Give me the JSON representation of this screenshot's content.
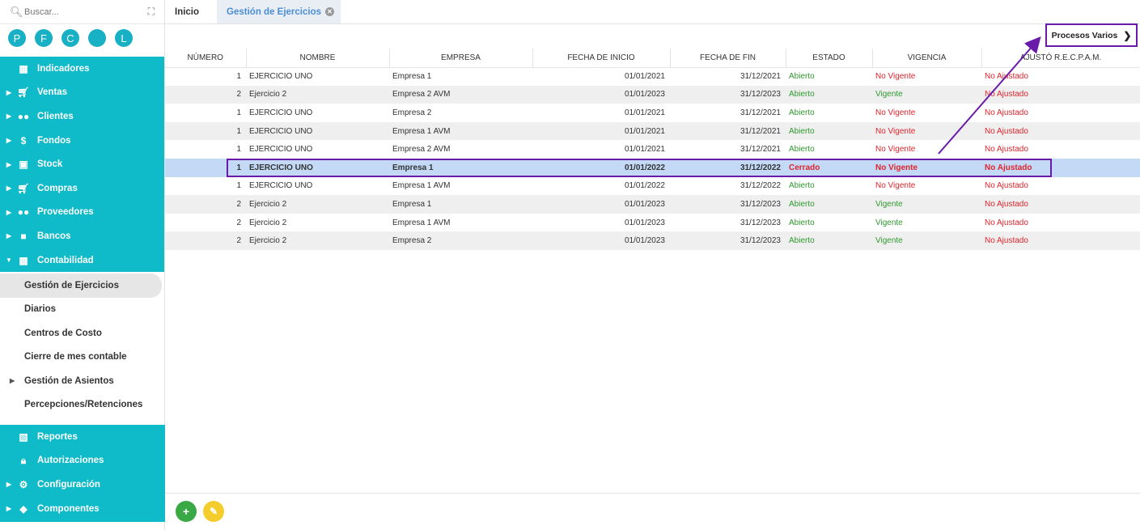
{
  "search": {
    "placeholder": "Buscar..."
  },
  "quick_circles": [
    "P",
    "F",
    "C",
    "",
    "L"
  ],
  "sidebar": {
    "items": [
      {
        "label": "Indicadores",
        "icon": "dashboard-icon",
        "caret": false
      },
      {
        "label": "Ventas",
        "icon": "cart-icon",
        "caret": true
      },
      {
        "label": "Clientes",
        "icon": "people-icon",
        "caret": true
      },
      {
        "label": "Fondos",
        "icon": "dollar-icon",
        "caret": true
      },
      {
        "label": "Stock",
        "icon": "box-icon",
        "caret": true
      },
      {
        "label": "Compras",
        "icon": "purchase-cart-icon",
        "caret": true
      },
      {
        "label": "Proveedores",
        "icon": "people-icon",
        "caret": true
      },
      {
        "label": "Bancos",
        "icon": "briefcase-icon",
        "caret": true
      },
      {
        "label": "Contabilidad",
        "icon": "book-icon",
        "caret": "open"
      }
    ],
    "sub_items": [
      {
        "label": "Gestión de Ejercicios",
        "active": true
      },
      {
        "label": "Diarios"
      },
      {
        "label": "Centros de Costo"
      },
      {
        "label": "Cierre de mes contable"
      },
      {
        "label": "Gestión de Asientos",
        "caret": true
      },
      {
        "label": "Percepciones/Retenciones"
      }
    ],
    "bottom_items": [
      {
        "label": "Reportes",
        "icon": "report-icon",
        "caret": false
      },
      {
        "label": "Autorizaciones",
        "icon": "lock-icon",
        "caret": false
      },
      {
        "label": "Configuración",
        "icon": "gears-icon",
        "caret": true
      },
      {
        "label": "Componentes",
        "icon": "tag-icon",
        "caret": true
      }
    ]
  },
  "tabs": [
    {
      "label": "Inicio"
    },
    {
      "label": "Gestión de Ejercicios",
      "active": true
    }
  ],
  "procesos": {
    "label": "Procesos Varios"
  },
  "table": {
    "columns": [
      "NÚMERO",
      "NOMBRE",
      "EMPRESA",
      "FECHA DE INICIO",
      "FECHA DE FIN",
      "ESTADO",
      "VIGENCIA",
      "AJUSTÓ R.E.C.P.A.M."
    ],
    "rows": [
      [
        "1",
        "EJERCICIO UNO",
        "Empresa 1",
        "01/01/2021",
        "31/12/2021",
        "Abierto",
        "No Vigente",
        "No Ajustado"
      ],
      [
        "2",
        "Ejercicio 2",
        "Empresa 2 AVM",
        "01/01/2023",
        "31/12/2023",
        "Abierto",
        "Vigente",
        "No Ajustado"
      ],
      [
        "1",
        "EJERCICIO UNO",
        "Empresa 2",
        "01/01/2021",
        "31/12/2021",
        "Abierto",
        "No Vigente",
        "No Ajustado"
      ],
      [
        "1",
        "EJERCICIO UNO",
        "Empresa 1 AVM",
        "01/01/2021",
        "31/12/2021",
        "Abierto",
        "No Vigente",
        "No Ajustado"
      ],
      [
        "1",
        "EJERCICIO UNO",
        "Empresa 2 AVM",
        "01/01/2021",
        "31/12/2021",
        "Abierto",
        "No Vigente",
        "No Ajustado"
      ],
      [
        "1",
        "EJERCICIO UNO",
        "Empresa 1",
        "01/01/2022",
        "31/12/2022",
        "Cerrado",
        "No Vigente",
        "No Ajustado"
      ],
      [
        "1",
        "EJERCICIO UNO",
        "Empresa 1 AVM",
        "01/01/2022",
        "31/12/2022",
        "Abierto",
        "No Vigente",
        "No Ajustado"
      ],
      [
        "2",
        "Ejercicio 2",
        "Empresa 1",
        "01/01/2023",
        "31/12/2023",
        "Abierto",
        "Vigente",
        "No Ajustado"
      ],
      [
        "2",
        "Ejercicio 2",
        "Empresa 1 AVM",
        "01/01/2023",
        "31/12/2023",
        "Abierto",
        "Vigente",
        "No Ajustado"
      ],
      [
        "2",
        "Ejercicio 2",
        "Empresa 2",
        "01/01/2023",
        "31/12/2023",
        "Abierto",
        "Vigente",
        "No Ajustado"
      ]
    ],
    "selected_row": 5
  },
  "colors": {
    "accent": "#0fbac9",
    "annotation": "#6a1aa8",
    "positive": "#2e9a2e",
    "negative": "#e0242c",
    "selected_row": "#c3d9f6"
  }
}
